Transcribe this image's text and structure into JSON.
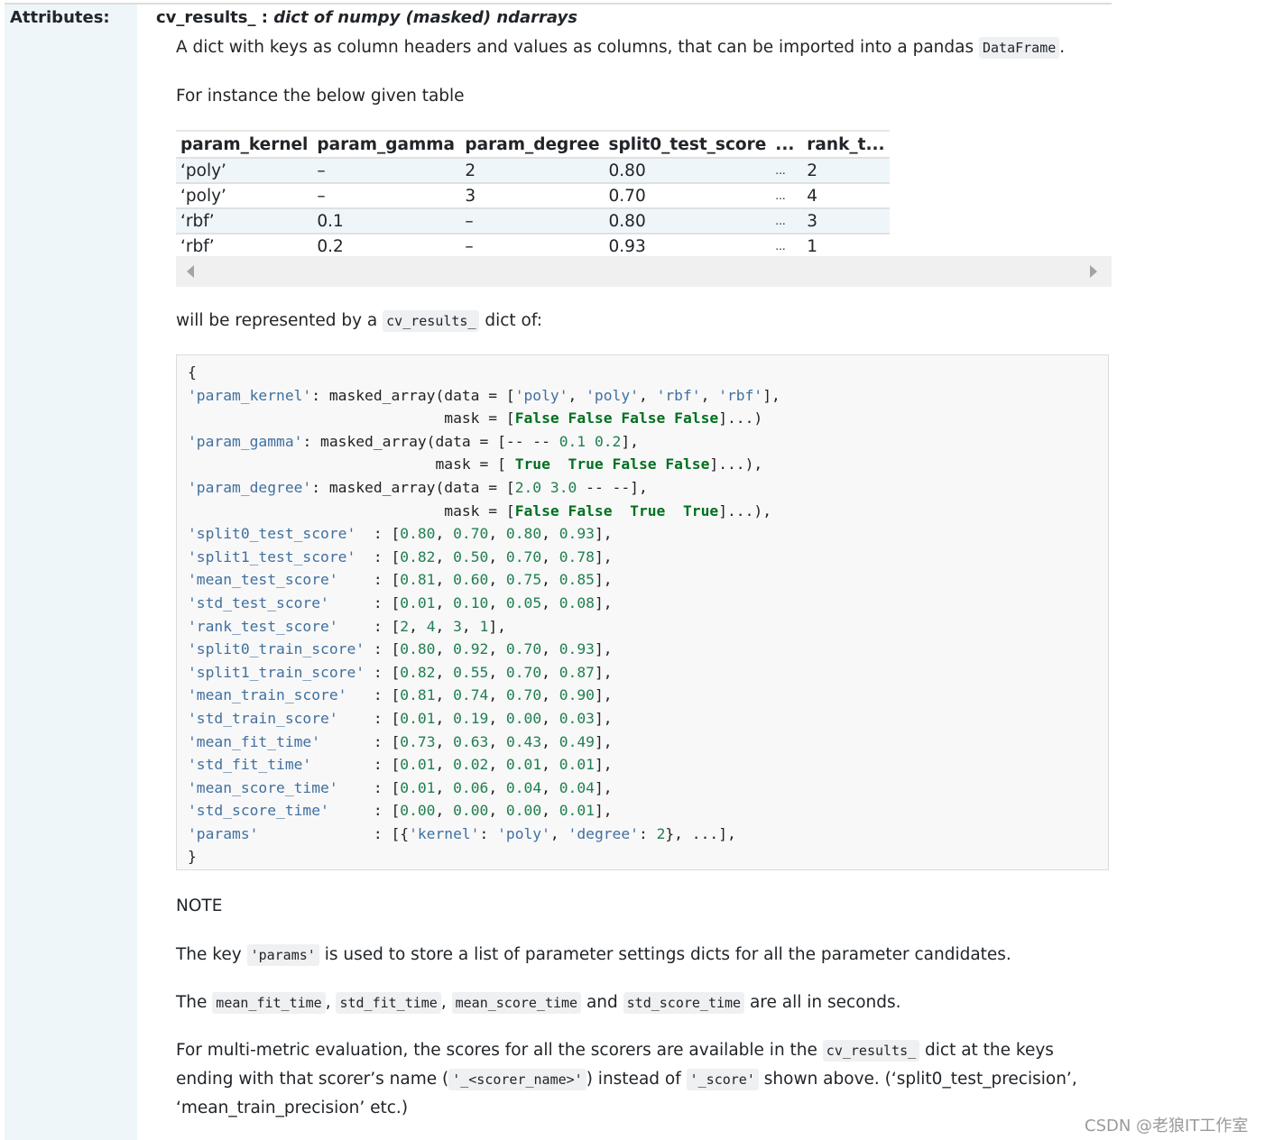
{
  "attribute": {
    "label": "Attributes:",
    "name": "cv_results_",
    "separator": " : ",
    "type": "dict of numpy (masked) ndarrays"
  },
  "intro": {
    "text_before": "A dict with keys as column headers and values as columns, that can be imported into a pandas ",
    "code": "DataFrame",
    "text_after": "."
  },
  "instance_text": "For instance the below given table",
  "table": {
    "headers": [
      "param_kernel",
      "param_gamma",
      "param_degree",
      "split0_test_score",
      "...",
      "rank_t..."
    ],
    "rows": [
      [
        "‘poly’",
        "–",
        "2",
        "0.80",
        "...",
        "2"
      ],
      [
        "‘poly’",
        "–",
        "3",
        "0.70",
        "...",
        "4"
      ],
      [
        "‘rbf’",
        "0.1",
        "–",
        "0.80",
        "...",
        "3"
      ],
      [
        "‘rbf’",
        "0.2",
        "–",
        "0.93",
        "...",
        "1"
      ]
    ]
  },
  "represented": {
    "text_before": "will be represented by a ",
    "code": "cv_results_",
    "text_after": " dict of:"
  },
  "code_block": {
    "open": "{",
    "param_kernel": {
      "key": "'param_kernel'",
      "data": [
        "'poly'",
        "'poly'",
        "'rbf'",
        "'rbf'"
      ],
      "mask": [
        "False",
        "False",
        "False",
        "False"
      ]
    },
    "param_gamma": {
      "key": "'param_gamma'",
      "data": [
        "--",
        "--",
        "0.1",
        "0.2"
      ],
      "mask": [
        "True",
        "True",
        "False",
        "False"
      ]
    },
    "param_degree": {
      "key": "'param_degree'",
      "data": [
        "2.0",
        "3.0",
        "--",
        "--"
      ],
      "mask": [
        "False",
        "False",
        "True",
        "True"
      ]
    },
    "entries": [
      {
        "key": "'split0_test_score'",
        "values": [
          "0.80",
          "0.70",
          "0.80",
          "0.93"
        ]
      },
      {
        "key": "'split1_test_score'",
        "values": [
          "0.82",
          "0.50",
          "0.70",
          "0.78"
        ]
      },
      {
        "key": "'mean_test_score'",
        "values": [
          "0.81",
          "0.60",
          "0.75",
          "0.85"
        ]
      },
      {
        "key": "'std_test_score'",
        "values": [
          "0.01",
          "0.10",
          "0.05",
          "0.08"
        ]
      },
      {
        "key": "'rank_test_score'",
        "values": [
          "2",
          "4",
          "3",
          "1"
        ]
      },
      {
        "key": "'split0_train_score'",
        "values": [
          "0.80",
          "0.92",
          "0.70",
          "0.93"
        ]
      },
      {
        "key": "'split1_train_score'",
        "values": [
          "0.82",
          "0.55",
          "0.70",
          "0.87"
        ]
      },
      {
        "key": "'mean_train_score'",
        "values": [
          "0.81",
          "0.74",
          "0.70",
          "0.90"
        ]
      },
      {
        "key": "'std_train_score'",
        "values": [
          "0.01",
          "0.19",
          "0.00",
          "0.03"
        ]
      },
      {
        "key": "'mean_fit_time'",
        "values": [
          "0.73",
          "0.63",
          "0.43",
          "0.49"
        ]
      },
      {
        "key": "'std_fit_time'",
        "values": [
          "0.01",
          "0.02",
          "0.01",
          "0.01"
        ]
      },
      {
        "key": "'mean_score_time'",
        "values": [
          "0.01",
          "0.06",
          "0.04",
          "0.04"
        ]
      },
      {
        "key": "'std_score_time'",
        "values": [
          "0.00",
          "0.00",
          "0.00",
          "0.01"
        ]
      }
    ],
    "params": {
      "key": "'params'",
      "kernel_key": "'kernel'",
      "kernel_val": "'poly'",
      "degree_key": "'degree'",
      "degree_val": "2"
    },
    "close": "}"
  },
  "note": {
    "heading": "NOTE",
    "params_line": {
      "before": "The key ",
      "code": "'params'",
      "after": " is used to store a list of parameter settings dicts for all the parameter candidates."
    },
    "seconds_line": {
      "before": "The ",
      "codes": [
        "mean_fit_time",
        "std_fit_time",
        "mean_score_time",
        "std_score_time"
      ],
      "sep1": ", ",
      "sep2": ", ",
      "sep3": " and ",
      "after": " are all in seconds."
    },
    "multimetric": {
      "l1_before": "For multi-metric evaluation, the scores for all the scorers are available in the ",
      "l1_code": "cv_results_",
      "l1_after": " dict at the keys",
      "l2_before": "ending with that scorer’s name (",
      "l2_code1": "'_<scorer_name>'",
      "l2_mid": ") instead of ",
      "l2_code2": "'_score'",
      "l2_after": " shown above. (‘split0_test_precision’,",
      "l3": "‘mean_train_precision’ etc.)"
    }
  },
  "watermark": "CSDN @老狼IT工作室"
}
